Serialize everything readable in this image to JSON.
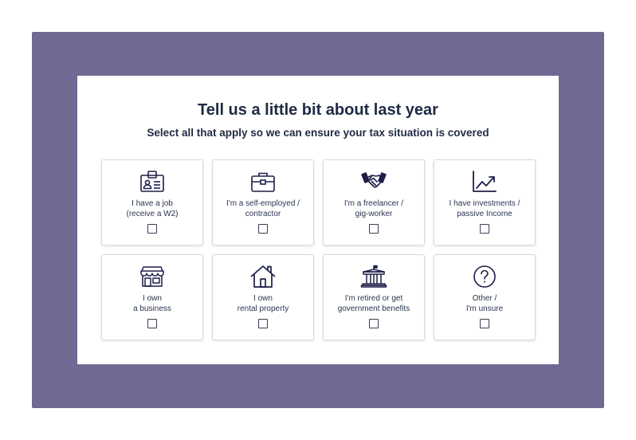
{
  "header": {
    "title": "Tell us a little bit about last year",
    "subtitle": "Select all that apply so we can ensure your tax situation is covered"
  },
  "options": [
    {
      "line1": "I have a job",
      "line2": "(receive a W2)",
      "icon": "id-badge-icon",
      "checked": false
    },
    {
      "line1": "I'm a self-employed /",
      "line2": "contractor",
      "icon": "briefcase-icon",
      "checked": false
    },
    {
      "line1": "I'm a freelancer /",
      "line2": "gig-worker",
      "icon": "handshake-icon",
      "checked": false
    },
    {
      "line1": "I have investments /",
      "line2": "passive Income",
      "icon": "trend-chart-icon",
      "checked": false
    },
    {
      "line1": "I own",
      "line2": "a business",
      "icon": "storefront-icon",
      "checked": false
    },
    {
      "line1": "I own",
      "line2": "rental property",
      "icon": "house-icon",
      "checked": false
    },
    {
      "line1": "I'm retired or get",
      "line2": "government benefits",
      "icon": "government-building-icon",
      "checked": false
    },
    {
      "line1": "Other /",
      "line2": "I'm unsure",
      "icon": "question-circle-icon",
      "checked": false
    }
  ],
  "colors": {
    "frame": "#6e6a93",
    "icon": "#1e1e4a",
    "text": "#1f2a44"
  }
}
